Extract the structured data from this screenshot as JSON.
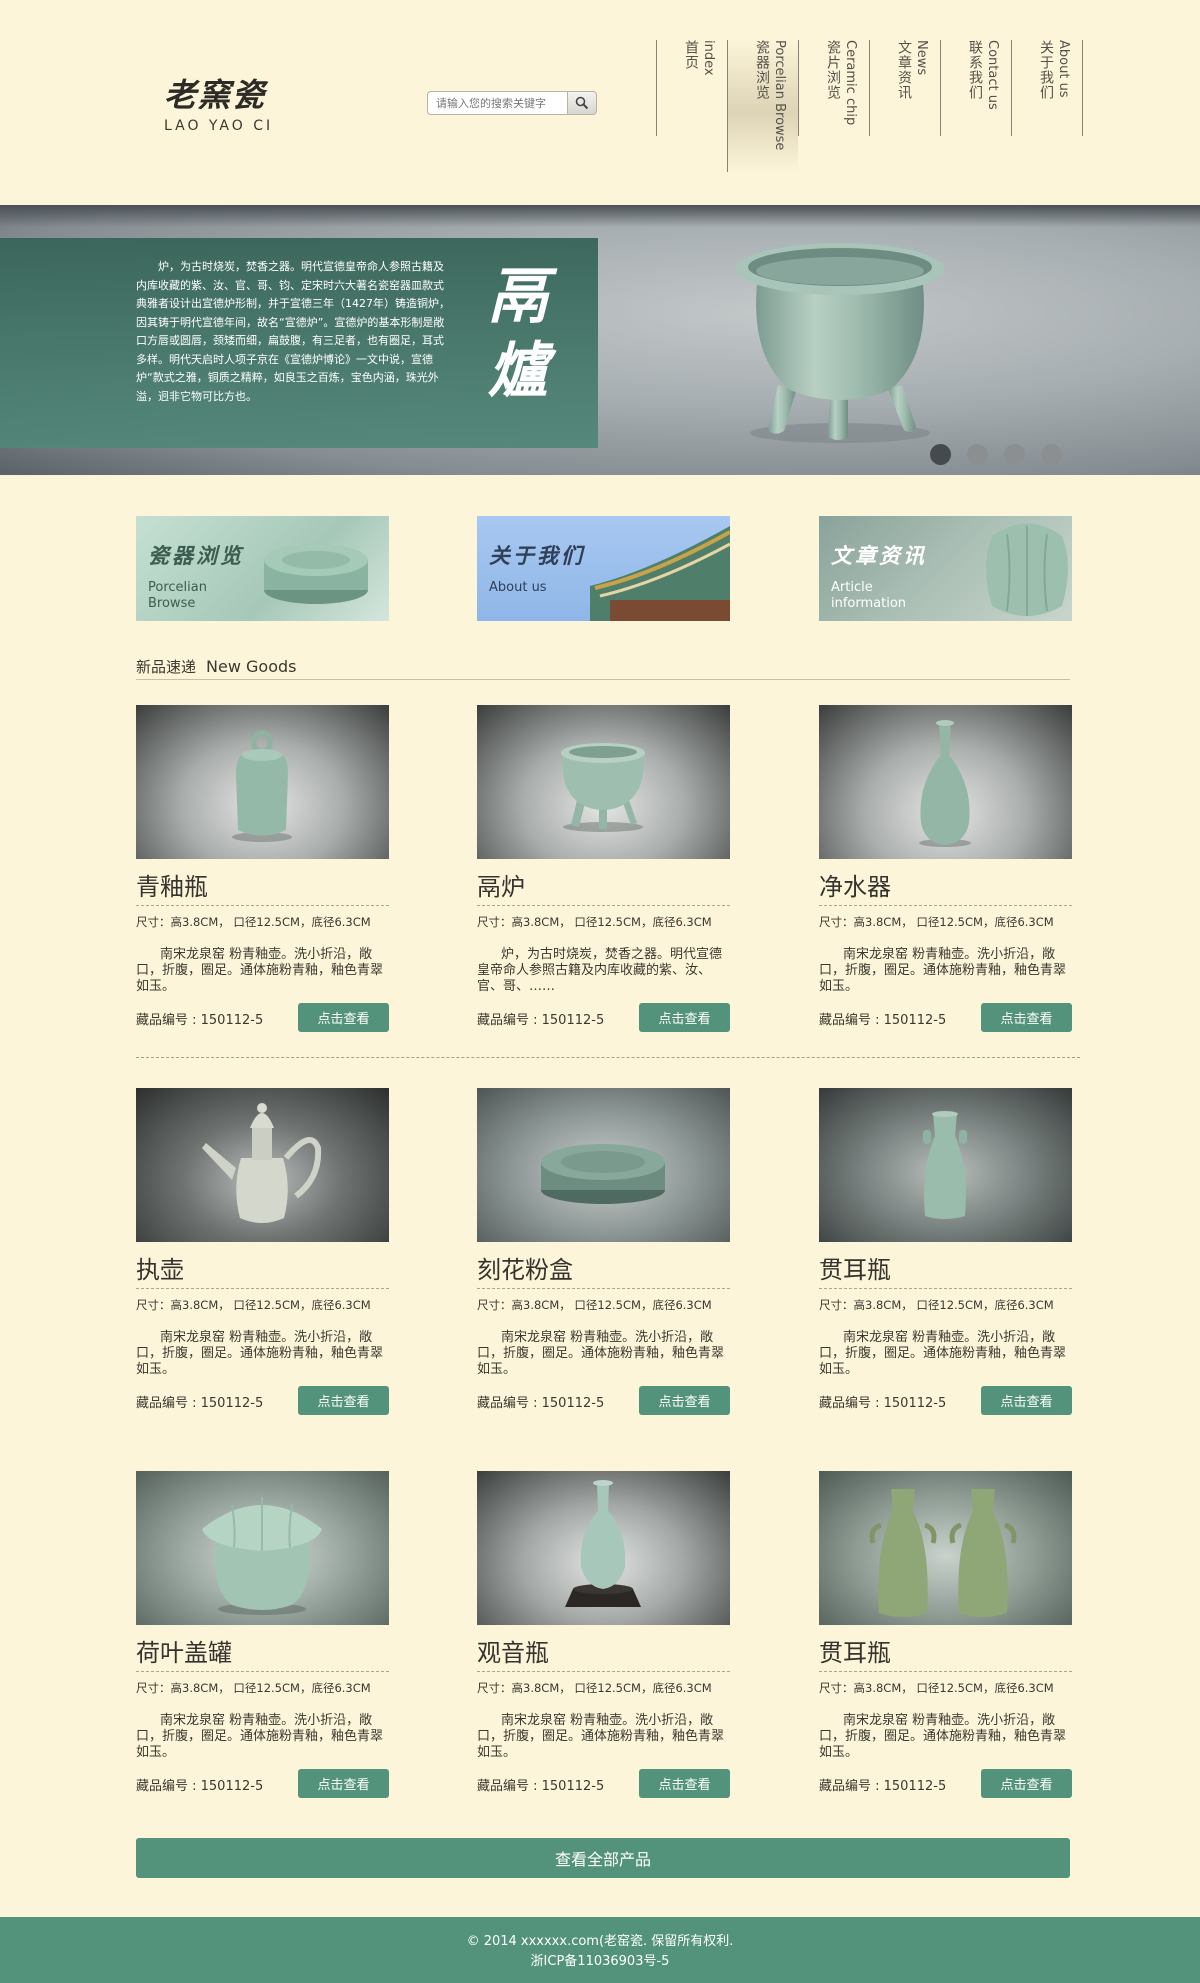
{
  "header": {
    "logo_cn": "老窯瓷",
    "logo_en": "LAO YAO CI",
    "search_placeholder": "请输入您的搜索关键字",
    "nav": [
      {
        "zh": "首页",
        "en": "index"
      },
      {
        "zh": "瓷器浏览",
        "en": "Porcelian Browse"
      },
      {
        "zh": "瓷片浏览",
        "en": "Ceramic chip"
      },
      {
        "zh": "文章资讯",
        "en": "News"
      },
      {
        "zh": "联系我们",
        "en": "Contact us"
      },
      {
        "zh": "关于我们",
        "en": "About us"
      }
    ]
  },
  "banner": {
    "text": "炉，为古时烧炭，焚香之器。明代宣德皇帝命人参照古籍及内库收藏的紫、汝、官、哥、钧、定宋时六大著名瓷窑器皿款式典雅者设计出宣德炉形制，并于宣德三年（1427年）铸造铜炉，因其铸于明代宣德年间，故名“宣德炉”。宣德炉的基本形制是敞口方唇或圆唇，颈矮而细，扁鼓腹，有三足者，也有圈足，耳式多样。明代天启时人项子京在《宣德炉博论》一文中说，宣德炉“款式之雅，铜质之精粹，如良玉之百炼，宝色内涵，珠光外溢，迥非它物可比方也。",
    "title": "鬲爐",
    "active_dot": 0,
    "dot_count": 4
  },
  "features": [
    {
      "zh": "瓷器浏览",
      "en": "Porcelian Browse"
    },
    {
      "zh": "关于我们",
      "en": "About us"
    },
    {
      "zh": "文章资讯",
      "en": "Article information"
    }
  ],
  "section": {
    "zh": "新品速递",
    "en": "New Goods"
  },
  "products": [
    {
      "name": "青釉瓶",
      "size": "尺寸：高3.8CM， 口径12.5CM，底径6.3CM",
      "desc": "南宋龙泉窑 粉青釉壶。洗小折沿，敞口，折腹，圈足。通体施粉青釉，釉色青翠如玉。",
      "num": "藏品编号 : 150112-5",
      "btn": "点击查看"
    },
    {
      "name": "鬲炉",
      "size": "尺寸：高3.8CM， 口径12.5CM，底径6.3CM",
      "desc": "炉，为古时烧炭，焚香之器。明代宣德皇帝命人参照古籍及内库收藏的紫、汝、官、哥、……",
      "num": "藏品编号 : 150112-5",
      "btn": "点击查看"
    },
    {
      "name": "净水器",
      "size": "尺寸：高3.8CM， 口径12.5CM，底径6.3CM",
      "desc": "南宋龙泉窑 粉青釉壶。洗小折沿，敞口，折腹，圈足。通体施粉青釉，釉色青翠如玉。",
      "num": "藏品编号 : 150112-5",
      "btn": "点击查看"
    },
    {
      "name": "执壶",
      "size": "尺寸：高3.8CM， 口径12.5CM，底径6.3CM",
      "desc": "南宋龙泉窑 粉青釉壶。洗小折沿，敞口，折腹，圈足。通体施粉青釉，釉色青翠如玉。",
      "num": "藏品编号 : 150112-5",
      "btn": "点击查看"
    },
    {
      "name": "刻花粉盒",
      "size": "尺寸：高3.8CM， 口径12.5CM，底径6.3CM",
      "desc": "南宋龙泉窑 粉青釉壶。洗小折沿，敞口，折腹，圈足。通体施粉青釉，釉色青翠如玉。",
      "num": "藏品编号 : 150112-5",
      "btn": "点击查看"
    },
    {
      "name": "贯耳瓶",
      "size": "尺寸：高3.8CM， 口径12.5CM，底径6.3CM",
      "desc": "南宋龙泉窑 粉青釉壶。洗小折沿，敞口，折腹，圈足。通体施粉青釉，釉色青翠如玉。",
      "num": "藏品编号 : 150112-5",
      "btn": "点击查看"
    },
    {
      "name": "荷叶盖罐",
      "size": "尺寸：高3.8CM， 口径12.5CM，底径6.3CM",
      "desc": "南宋龙泉窑 粉青釉壶。洗小折沿，敞口，折腹，圈足。通体施粉青釉，釉色青翠如玉。",
      "num": "藏品编号 : 150112-5",
      "btn": "点击查看"
    },
    {
      "name": "观音瓶",
      "size": "尺寸：高3.8CM， 口径12.5CM，底径6.3CM",
      "desc": "南宋龙泉窑 粉青釉壶。洗小折沿，敞口，折腹，圈足。通体施粉青釉，釉色青翠如玉。",
      "num": "藏品编号 : 150112-5",
      "btn": "点击查看"
    },
    {
      "name": "贯耳瓶",
      "size": "尺寸：高3.8CM， 口径12.5CM，底径6.3CM",
      "desc": "南宋龙泉窑 粉青釉壶。洗小折沿，敞口，折腹，圈足。通体施粉青釉，釉色青翠如玉。",
      "num": "藏品编号 : 150112-5",
      "btn": "点击查看"
    }
  ],
  "view_all": "查看全部产品",
  "footer": {
    "line1": "© 2014 xxxxxx.com(老窑瓷. 保留所有权利.",
    "line2": "浙ICP备11036903号-5"
  },
  "colors": {
    "accent": "#53937c",
    "background": "#fdf5d9"
  }
}
